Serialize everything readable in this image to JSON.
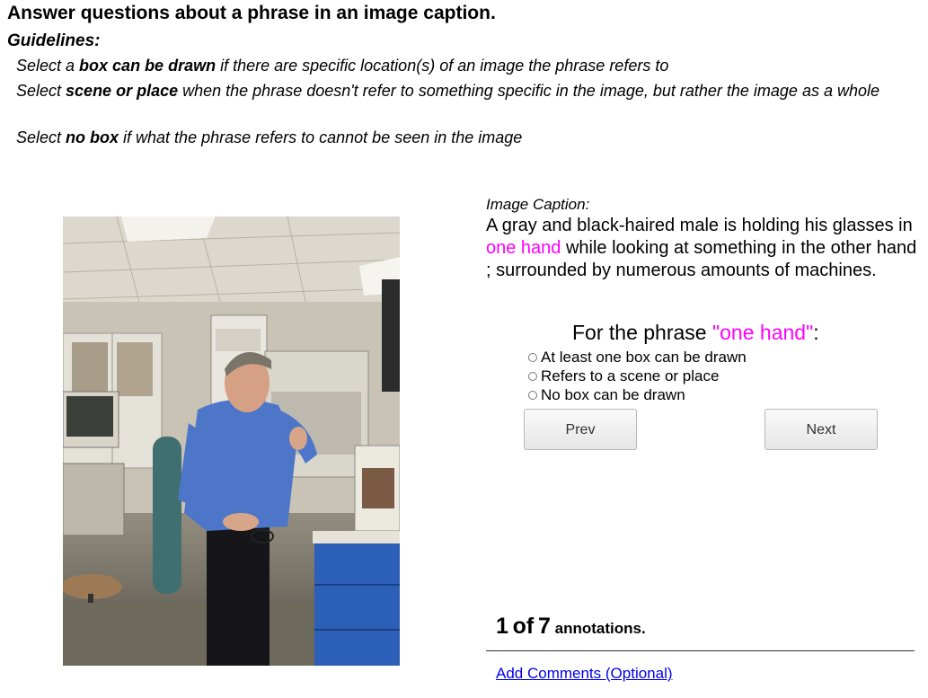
{
  "header": {
    "title": "Answer questions about a phrase in an image caption.",
    "guidelines_heading": "Guidelines:"
  },
  "guidelines": [
    {
      "pre": "Select a ",
      "bold": "box can be drawn",
      "post": " if there are specific location(s) of an image the phrase refers to"
    },
    {
      "pre": "Select ",
      "bold": "scene or place",
      "post": " when the phrase doesn't refer to something specific in the image, but rather the image as a whole"
    },
    {
      "pre": "Select ",
      "bold": "no box",
      "post": " if what the phrase refers to cannot be seen in the image"
    }
  ],
  "caption": {
    "label": "Image Caption",
    "label_suffix": ":",
    "before": "A gray and black-haired male is holding his glasses in ",
    "highlight": "one hand",
    "after": " while looking at something in the other hand ; surrounded by numerous amounts of machines.",
    "highlight_color": "#ff00ff"
  },
  "question": {
    "prefix": "For the phrase ",
    "phrase": "\"one hand\"",
    "suffix": ":"
  },
  "options": [
    {
      "label": "At least one box can be drawn",
      "selected": false
    },
    {
      "label": "Refers to a scene or place",
      "selected": false
    },
    {
      "label": "No box can be drawn",
      "selected": false
    }
  ],
  "buttons": {
    "prev": "Prev",
    "next": "Next"
  },
  "progress": {
    "current": "1",
    "of_text": "of",
    "total": "7",
    "suffix": "annotations."
  },
  "comments_link": "Add Comments (Optional)"
}
